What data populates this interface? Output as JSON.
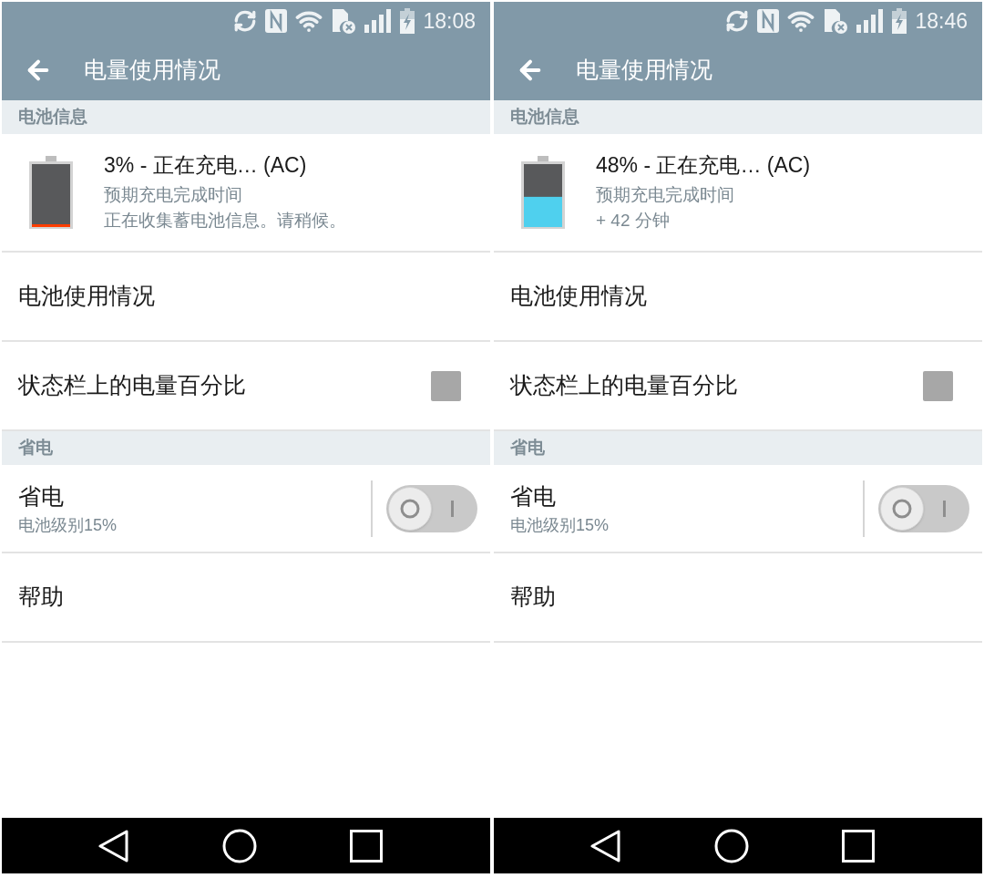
{
  "screens": [
    {
      "status_bar": {
        "time": "18:08"
      },
      "app_bar": {
        "title": "电量使用情况"
      },
      "rows": [
        {
          "kind": "header",
          "label": "电池信息"
        },
        {
          "kind": "battery",
          "level": 0.03,
          "title": "3% - 正在充电… (AC)",
          "lines": [
            "预期充电完成时间",
            "正在收集蓄电池信息。请稍候。"
          ]
        },
        {
          "kind": "link",
          "label": "电池使用情况"
        },
        {
          "kind": "checkbox",
          "label": "状态栏上的电量百分比",
          "checked": false
        },
        {
          "kind": "header",
          "label": "省电"
        },
        {
          "kind": "switch",
          "label": "省电",
          "summary": "电池级别15%",
          "on": false
        },
        {
          "kind": "link",
          "label": "帮助"
        }
      ]
    },
    {
      "status_bar": {
        "time": "18:46"
      },
      "app_bar": {
        "title": "电量使用情况"
      },
      "rows": [
        {
          "kind": "header",
          "label": "电池信息"
        },
        {
          "kind": "battery",
          "level": 0.48,
          "title": "48% - 正在充电… (AC)",
          "lines": [
            "预期充电完成时间",
            "+ 42 分钟"
          ]
        },
        {
          "kind": "link",
          "label": "电池使用情况"
        },
        {
          "kind": "checkbox",
          "label": "状态栏上的电量百分比",
          "checked": false
        },
        {
          "kind": "header",
          "label": "省电"
        },
        {
          "kind": "switch",
          "label": "省电",
          "summary": "电池级别15%",
          "on": false
        },
        {
          "kind": "link",
          "label": "帮助"
        }
      ]
    }
  ]
}
